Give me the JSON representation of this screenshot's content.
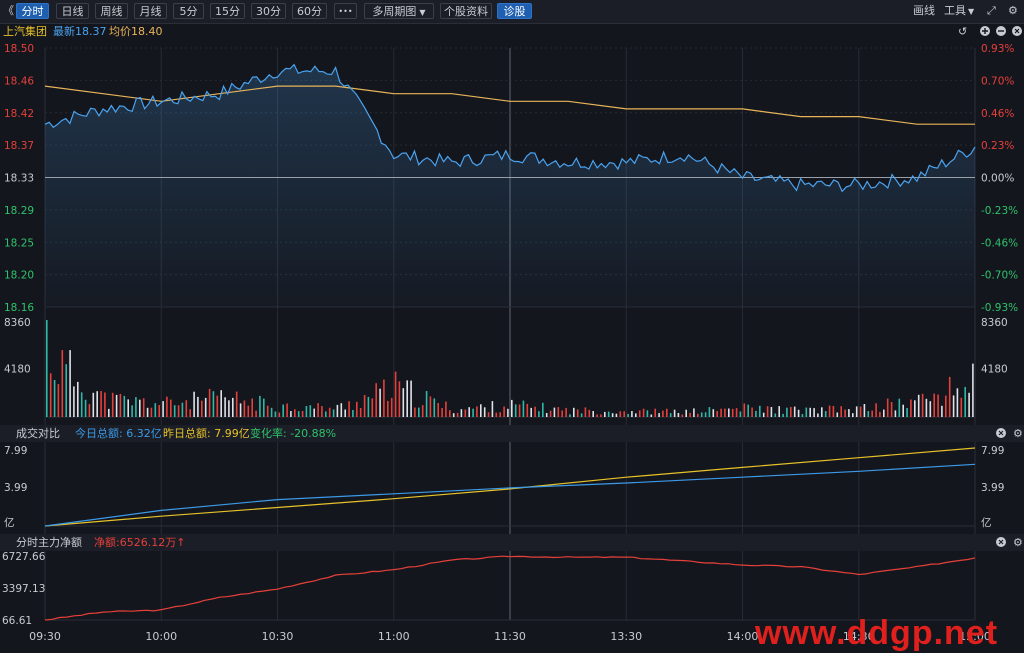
{
  "toolbar": {
    "back_glyph": "《",
    "tabs": [
      "分时",
      "日线",
      "周线",
      "月线",
      "5分",
      "15分",
      "30分",
      "60分"
    ],
    "more_glyph": "•••",
    "multi_period": "多周期图",
    "stock_info": "个股资料",
    "diagnose": "诊股",
    "draw": "画线",
    "tools": "工具",
    "expand_glyph": "⤢",
    "settings_glyph": "⚙"
  },
  "price_panel": {
    "stock_name": "上汽集团",
    "latest": "最新18.37",
    "avg": "均价18.40",
    "tick_labels_left": [
      "18.50",
      "18.46",
      "18.42",
      "18.37",
      "18.33",
      "18.29",
      "18.25",
      "18.20",
      "18.16"
    ],
    "tick_labels_right": [
      "0.93%",
      "0.70%",
      "0.46%",
      "0.23%",
      "0.00%",
      "-0.23%",
      "-0.46%",
      "-0.70%",
      "-0.93%"
    ]
  },
  "volume_panel": {
    "tick_labels": [
      "8360",
      "4180"
    ]
  },
  "compare_panel": {
    "title": "成交对比",
    "today": "今日总额: 6.32亿",
    "yesterday": "昨日总额: 7.99亿",
    "change": "变化率: -20.88%",
    "tick_labels": [
      "7.99",
      "3.99",
      "亿"
    ]
  },
  "flow_panel": {
    "title": "分时主力净额",
    "net": "净额:6526.12万↑",
    "tick_labels": [
      "6727.66",
      "3397.13",
      "66.61"
    ]
  },
  "time_labels": [
    "09:30",
    "10:00",
    "10:30",
    "11:00",
    "11:30",
    "13:30",
    "14:00",
    "14:30",
    "15:00"
  ],
  "watermark": "www.ddgp.net",
  "colors": {
    "price_line": "#4aa3f0",
    "avg_line": "#e8b45a",
    "up": "#e5403a",
    "down": "#2fb8a8",
    "today_line": "#3b9ae8",
    "yesterday_line": "#e6c229",
    "flow_line": "#e5403a"
  },
  "chart_data": [
    {
      "type": "line",
      "ylim": [
        18.16,
        18.5
      ],
      "reference": 18.33,
      "x": [
        "09:30",
        "09:45",
        "10:00",
        "10:15",
        "10:30",
        "10:45",
        "11:00",
        "11:15",
        "11:30",
        "13:15",
        "13:30",
        "13:45",
        "14:00",
        "14:15",
        "14:30",
        "14:45",
        "15:00"
      ],
      "series": [
        {
          "values": [
            18.4,
            18.42,
            18.43,
            18.44,
            18.47,
            18.47,
            18.36,
            18.35,
            18.36,
            18.35,
            18.35,
            18.36,
            18.33,
            18.32,
            18.32,
            18.33,
            18.37
          ]
        },
        {
          "values": [
            18.45,
            18.44,
            18.43,
            18.44,
            18.45,
            18.45,
            18.44,
            18.44,
            18.43,
            18.43,
            18.42,
            18.42,
            18.42,
            18.41,
            18.41,
            18.4,
            18.4
          ]
        }
      ]
    },
    {
      "type": "bar",
      "ylim": [
        0,
        8360
      ],
      "x": [
        "09:30",
        "09:45",
        "10:00",
        "10:15",
        "10:30",
        "10:45",
        "11:00",
        "11:15",
        "11:30",
        "13:15",
        "13:30",
        "13:45",
        "14:00",
        "14:15",
        "14:30",
        "14:45",
        "15:00"
      ],
      "values": [
        8360,
        2400,
        1800,
        2600,
        1500,
        1200,
        4000,
        1000,
        1600,
        900,
        800,
        700,
        1200,
        900,
        1100,
        2200,
        4600
      ]
    },
    {
      "type": "line",
      "ylim": [
        0,
        7.99
      ],
      "x": [
        "09:30",
        "10:00",
        "10:30",
        "11:00",
        "11:30",
        "13:30",
        "14:00",
        "14:30",
        "15:00"
      ],
      "series": [
        {
          "values": [
            0.0,
            1.6,
            2.7,
            3.3,
            3.9,
            4.4,
            5.0,
            5.6,
            6.32
          ]
        },
        {
          "values": [
            0.0,
            1.0,
            1.9,
            2.8,
            3.8,
            5.0,
            6.0,
            7.0,
            7.99
          ]
        }
      ]
    },
    {
      "type": "line",
      "ylim": [
        66.61,
        6727.66
      ],
      "x": [
        "09:30",
        "09:45",
        "10:00",
        "10:15",
        "10:30",
        "10:45",
        "11:00",
        "11:15",
        "11:30",
        "13:15",
        "13:30",
        "13:45",
        "14:00",
        "14:15",
        "14:30",
        "14:45",
        "15:00"
      ],
      "values": [
        66.61,
        900,
        1100,
        2400,
        3300,
        4700,
        5300,
        6300,
        6700,
        6600,
        6600,
        6200,
        5800,
        5600,
        4800,
        5600,
        6526.12
      ]
    }
  ]
}
